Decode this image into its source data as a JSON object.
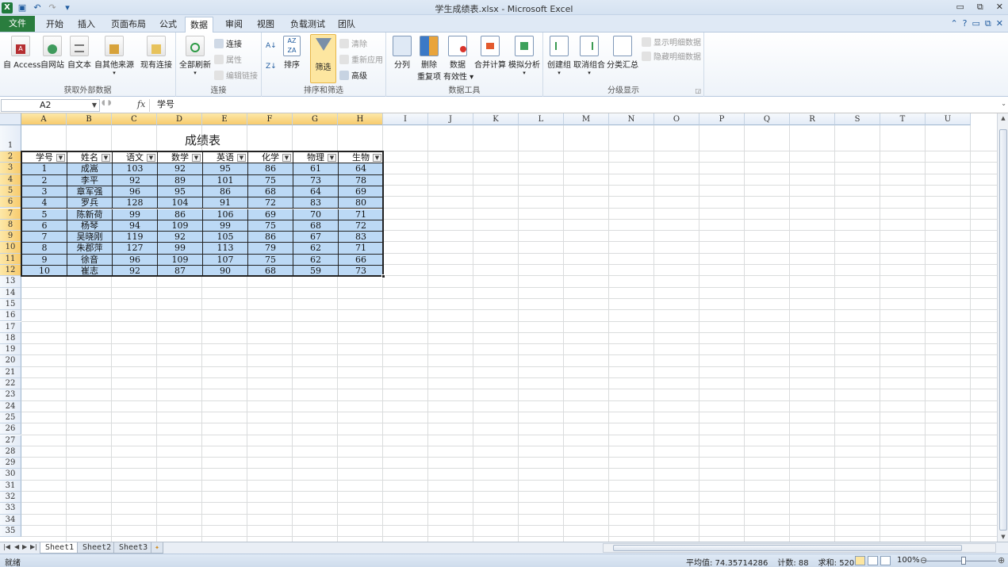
{
  "window": {
    "title": "学生成绩表.xlsx - Microsoft Excel",
    "controls": {
      "minimize": "▭",
      "restore": "⧉",
      "close": "✕"
    }
  },
  "tabs": {
    "file": "文件",
    "items": [
      "开始",
      "插入",
      "页面布局",
      "公式",
      "数据",
      "审阅",
      "视图",
      "负载测试",
      "团队"
    ],
    "active": "数据"
  },
  "ribbon": {
    "groups": {
      "external": "获取外部数据",
      "connections": "连接",
      "sort_filter": "排序和筛选",
      "data_tools": "数据工具",
      "outline": "分级显示"
    },
    "buttons": {
      "from_access": "自 Access",
      "from_web": "自网站",
      "from_text": "自文本",
      "from_other": "自其他来源",
      "existing": "现有连接",
      "refresh_all": "全部刷新",
      "connections": "连接",
      "properties": "属性",
      "edit_links": "编辑链接",
      "sort": "排序",
      "filter": "筛选",
      "clear": "清除",
      "reapply": "重新应用",
      "advanced": "高级",
      "text_to_columns": "分列",
      "remove_dup_1": "删除",
      "remove_dup_2": "重复项",
      "validation_1": "数据",
      "validation_2": "有效性",
      "consolidate": "合并计算",
      "what_if": "模拟分析",
      "group": "创建组",
      "ungroup": "取消组合",
      "subtotal": "分类汇总",
      "show_detail": "显示明细数据",
      "hide_detail": "隐藏明细数据"
    }
  },
  "formula_bar": {
    "name_box": "A2",
    "fx": "fx",
    "content": "学号"
  },
  "grid": {
    "columns": [
      "A",
      "B",
      "C",
      "D",
      "E",
      "F",
      "G",
      "H",
      "I",
      "J",
      "K",
      "L",
      "M",
      "N",
      "O",
      "P",
      "Q",
      "R",
      "S",
      "T",
      "U"
    ],
    "rows": [
      "1",
      "2",
      "3",
      "4",
      "5",
      "6",
      "7",
      "8",
      "9",
      "10",
      "11",
      "12",
      "13",
      "14",
      "15",
      "16",
      "17",
      "18",
      "19",
      "20",
      "21",
      "22",
      "23",
      "24",
      "25",
      "26",
      "27",
      "28",
      "29",
      "30",
      "31",
      "32",
      "33",
      "34",
      "35"
    ],
    "sheet_title": "成绩表",
    "headers": [
      "学号",
      "姓名",
      "语文",
      "数学",
      "英语",
      "化学",
      "物理",
      "生物"
    ],
    "data": [
      [
        "1",
        "成嵩",
        "103",
        "92",
        "95",
        "86",
        "61",
        "64"
      ],
      [
        "2",
        "李平",
        "92",
        "89",
        "101",
        "75",
        "73",
        "78"
      ],
      [
        "3",
        "章军强",
        "96",
        "95",
        "86",
        "68",
        "64",
        "69"
      ],
      [
        "4",
        "罗兵",
        "128",
        "104",
        "91",
        "72",
        "83",
        "80"
      ],
      [
        "5",
        "陈新荷",
        "99",
        "86",
        "106",
        "69",
        "70",
        "71"
      ],
      [
        "6",
        "杨琴",
        "94",
        "109",
        "99",
        "75",
        "68",
        "72"
      ],
      [
        "7",
        "吴晓刚",
        "119",
        "92",
        "105",
        "86",
        "67",
        "83"
      ],
      [
        "8",
        "朱郡萍",
        "127",
        "99",
        "113",
        "79",
        "62",
        "71"
      ],
      [
        "9",
        "徐音",
        "96",
        "109",
        "107",
        "75",
        "62",
        "66"
      ],
      [
        "10",
        "崔志",
        "92",
        "87",
        "90",
        "68",
        "59",
        "73"
      ]
    ]
  },
  "sheets": [
    "Sheet1",
    "Sheet2",
    "Sheet3"
  ],
  "status": {
    "ready": "就绪",
    "average": "平均值: 74.35714286",
    "count": "计数: 88",
    "sum": "求和: 5205",
    "zoom": "100%"
  },
  "colors": {
    "accent": "#2a7d3e",
    "selection_fill": "#bcd9f5",
    "header_highlight": "#f7cb6e"
  }
}
